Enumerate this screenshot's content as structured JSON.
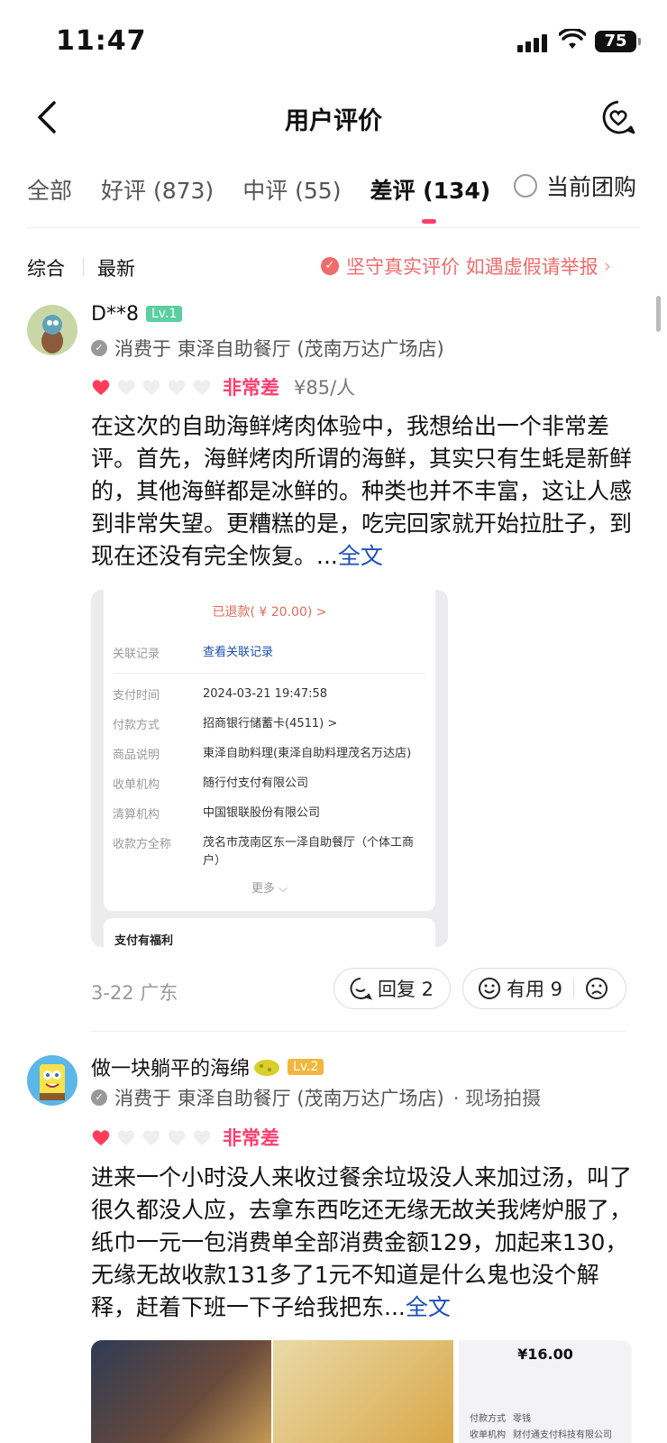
{
  "status_bar": {
    "time": "11:47",
    "battery": "75"
  },
  "header": {
    "title": "用户评价"
  },
  "tabs": [
    {
      "label": "全部"
    },
    {
      "label": "好评 (873)"
    },
    {
      "label": "中评 (55)"
    },
    {
      "label": "差评 (134)"
    }
  ],
  "filter": {
    "current_group": "当前团购"
  },
  "sort": {
    "comprehensive": "综合",
    "latest": "最新"
  },
  "notice": "坚守真实评价 如遇虚假请举报",
  "reviews": [
    {
      "user": "D**8",
      "level": "Lv.1",
      "consumed_at": "消费于 東泽自助餐厅 (茂南万达广场店)",
      "rating_text": "非常差",
      "rating": 1,
      "price": "¥85/人",
      "text": "在这次的自助海鲜烤肉体验中，我想给出一个非常差评。首先，海鲜烤肉所谓的海鲜，其实只有生蚝是新鲜的，其他海鲜都是冰鲜的。种类也并不丰富，这让人感到非常失望。更糟糕的是，吃完回家就开始拉肚子，到现在还没有完全恢复。...",
      "full_label": "全文",
      "receipt": {
        "refund": "已退款( ¥ 20.00) >",
        "rows": [
          {
            "k": "关联记录",
            "v": "查看关联记录"
          },
          {
            "k": "支付时间",
            "v": "2024-03-21 19:47:58"
          },
          {
            "k": "付款方式",
            "v": "招商银行储蓄卡(4511) >"
          },
          {
            "k": "商品说明",
            "v": "東泽自助料理(東泽自助料理茂名万达店)"
          },
          {
            "k": "收单机构",
            "v": "随行付支付有限公司"
          },
          {
            "k": "清算机构",
            "v": "中国银联股份有限公司"
          },
          {
            "k": "收款方全称",
            "v": "茂名市茂南区东一泽自助餐厅（个体工商户）"
          }
        ],
        "more": "更多 ⌵",
        "benefit": "支付有福利"
      },
      "date_loc": "3-22  广东",
      "reply_label": "回复 2",
      "useful_label": "有用 9"
    },
    {
      "user": "做一块躺平的海绵",
      "level": "Lv.2",
      "consumed_at": "消费于 東泽自助餐厅 (茂南万达广场店)",
      "tag": "· 现场拍摄",
      "rating_text": "非常差",
      "rating": 1,
      "text": "进来一个小时没人来收过餐余垃圾没人来加过汤，叫了很久都没人应，去拿东西吃还无缘无故关我烤炉服了，纸巾一元一包消费单全部消费金额129，加起来130，无缘无故收款131多了1元不知道是什么鬼也没个解释，赶着下班一下子给我把东...",
      "full_label": "全文",
      "thumb_amount": "¥16.00",
      "thumb_rows": [
        {
          "k": "付款方式",
          "v": "零钱"
        },
        {
          "k": "收单机构",
          "v": "财付通支付科技有限公司"
        }
      ]
    }
  ],
  "colors": {
    "accent": "#ff3d6e",
    "link": "#1c4fb5",
    "lv1": "#5bcf9f",
    "lv2": "#f4b63b"
  }
}
